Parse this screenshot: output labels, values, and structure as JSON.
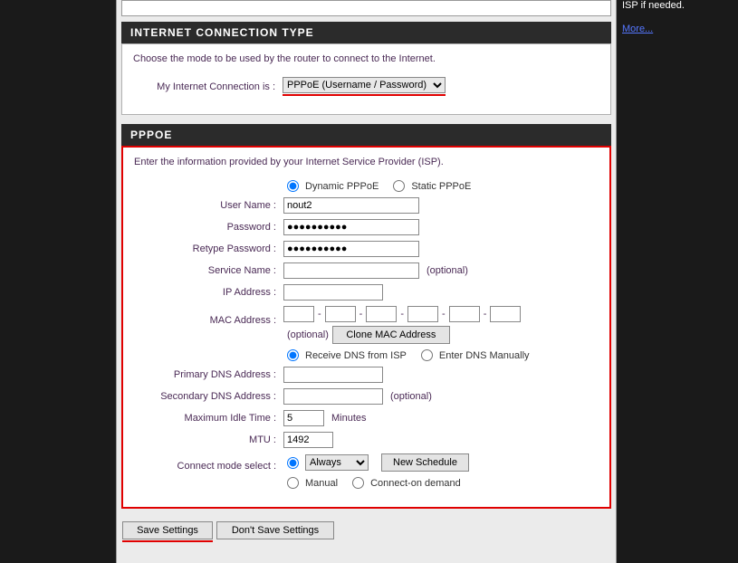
{
  "right": {
    "hint": "ISP if needed.",
    "more": "More..."
  },
  "connType": {
    "header": "INTERNET CONNECTION TYPE",
    "intro": "Choose the mode to be used by the router to connect to the Internet.",
    "conn_label": "My Internet Connection is :",
    "selected": "PPPoE (Username / Password)"
  },
  "pppoe": {
    "header": "PPPOE",
    "intro": "Enter the information provided by your Internet Service Provider (ISP).",
    "dynamic_label": "Dynamic PPPoE",
    "static_label": "Static PPPoE",
    "username_label": "User Name :",
    "username_value": "nout2",
    "password_label": "Password :",
    "password_value": "●●●●●●●●●●",
    "retype_label": "Retype Password :",
    "retype_value": "●●●●●●●●●●",
    "service_label": "Service Name :",
    "service_value": "",
    "optional": "(optional)",
    "ip_label": "IP Address :",
    "ip_value": "",
    "mac_label": "MAC Address :",
    "clone_btn": "Clone MAC Address",
    "dns_receive": "Receive DNS from ISP",
    "dns_manual": "Enter DNS Manually",
    "primary_dns_label": "Primary DNS Address :",
    "secondary_dns_label": "Secondary DNS Address :",
    "idle_label": "Maximum Idle Time :",
    "idle_value": "5",
    "minutes": "Minutes",
    "mtu_label": "MTU :",
    "mtu_value": "1492",
    "connect_label": "Connect mode select :",
    "always": "Always",
    "new_schedule": "New Schedule",
    "manual": "Manual",
    "ondemand": "Connect-on demand"
  },
  "buttons": {
    "save": "Save Settings",
    "dont": "Don't Save Settings"
  }
}
